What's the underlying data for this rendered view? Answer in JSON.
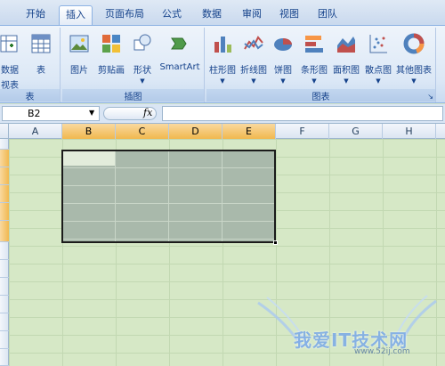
{
  "tabs": [
    {
      "label": "开始",
      "active": false
    },
    {
      "label": "插入",
      "active": true
    },
    {
      "label": "页面布局",
      "active": false
    },
    {
      "label": "公式",
      "active": false
    },
    {
      "label": "数据",
      "active": false
    },
    {
      "label": "审阅",
      "active": false
    },
    {
      "label": "视图",
      "active": false
    },
    {
      "label": "团队",
      "active": false
    }
  ],
  "ribbon": {
    "tables_group": {
      "label": "表",
      "pivot_label": "数据",
      "pivot_label2": "视表",
      "table_label": "表"
    },
    "illustrations_group": {
      "label": "插图",
      "picture": "图片",
      "clipart": "剪贴画",
      "shapes": "形状",
      "smartart": "SmartArt"
    },
    "charts_group": {
      "label": "图表",
      "column": "柱形图",
      "line": "折线图",
      "pie": "饼图",
      "bar": "条形图",
      "area": "面积图",
      "scatter": "散点图",
      "other": "其他图表"
    }
  },
  "formula_bar": {
    "name_box": "B2",
    "fx_label": "fx",
    "formula": ""
  },
  "columns": [
    "A",
    "B",
    "C",
    "D",
    "E",
    "F",
    "G",
    "H"
  ],
  "selected_columns": [
    "B",
    "C",
    "D",
    "E"
  ],
  "watermark": {
    "text": "我爱IT技术网",
    "url": "www.52ij.com"
  },
  "colors": {
    "selection_border": "#1b1b1b",
    "header_selected": "#f1b84f",
    "sheet_bg": "#d6e8c6"
  }
}
